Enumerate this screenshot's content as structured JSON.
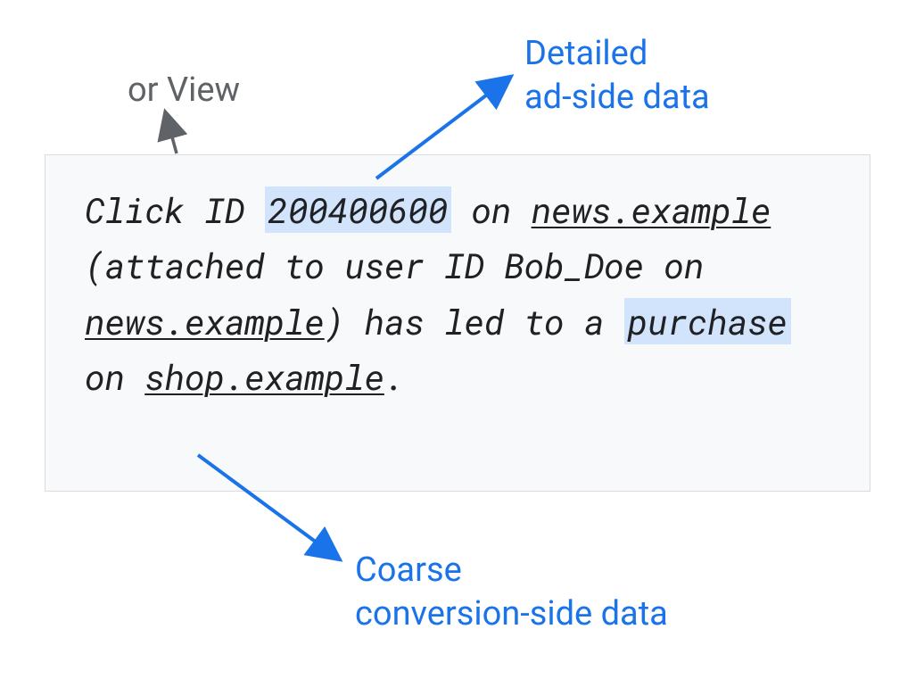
{
  "labels": {
    "top_view": "or View",
    "top_detailed_line1": "Detailed",
    "top_detailed_line2": "ad-side data",
    "bottom_line1": "Coarse",
    "bottom_line2": "conversion-side data"
  },
  "content": {
    "text1": "Click ID ",
    "click_id": "200400600",
    "text2": " on ",
    "site1": "news.example",
    "text3": " (attached to user ID Bob_Doe on ",
    "site2": "news.example",
    "text4": ") has led to a ",
    "action": "purchase",
    "text5": " on ",
    "site3": "shop.example",
    "text6": "."
  }
}
